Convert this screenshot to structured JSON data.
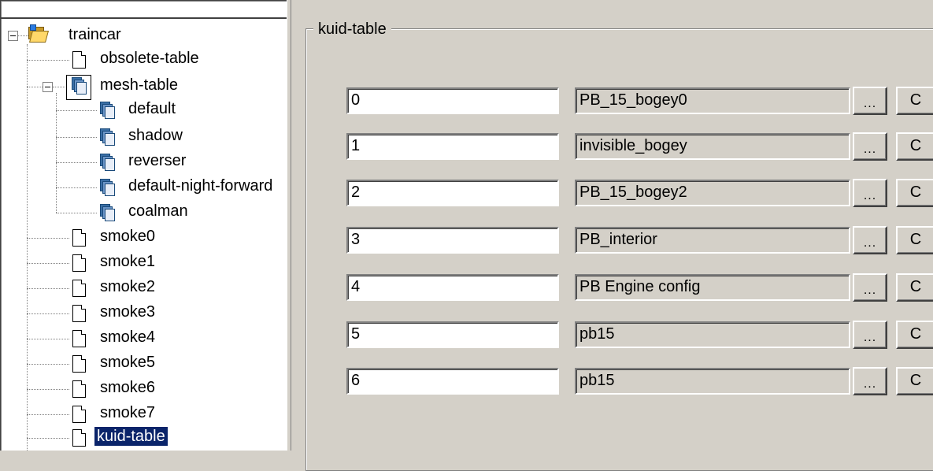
{
  "tree": {
    "root": {
      "label": "traincar",
      "icon": "folder-icon"
    },
    "nodes": [
      {
        "label": "obsolete-table",
        "icon": "doc-icon"
      },
      {
        "label": "mesh-table",
        "icon": "mesh-icon"
      },
      {
        "label": "default",
        "icon": "mesh-icon"
      },
      {
        "label": "shadow",
        "icon": "mesh-icon"
      },
      {
        "label": "reverser",
        "icon": "mesh-icon"
      },
      {
        "label": "default-night-forward",
        "icon": "mesh-icon"
      },
      {
        "label": "coalman",
        "icon": "mesh-icon"
      },
      {
        "label": "smoke0",
        "icon": "doc-icon"
      },
      {
        "label": "smoke1",
        "icon": "doc-icon"
      },
      {
        "label": "smoke2",
        "icon": "doc-icon"
      },
      {
        "label": "smoke3",
        "icon": "doc-icon"
      },
      {
        "label": "smoke4",
        "icon": "doc-icon"
      },
      {
        "label": "smoke5",
        "icon": "doc-icon"
      },
      {
        "label": "smoke6",
        "icon": "doc-icon"
      },
      {
        "label": "smoke7",
        "icon": "doc-icon"
      },
      {
        "label": "kuid-table",
        "icon": "doc-icon",
        "selected": true
      }
    ]
  },
  "kuid_table": {
    "title": "kuid-table",
    "browse_label": "...",
    "clear_label": "C",
    "rows": [
      {
        "index": "0",
        "kuid": "PB_15_bogey0"
      },
      {
        "index": "1",
        "kuid": "invisible_bogey"
      },
      {
        "index": "2",
        "kuid": "PB_15_bogey2"
      },
      {
        "index": "3",
        "kuid": "PB_interior"
      },
      {
        "index": "4",
        "kuid": "PB Engine config"
      },
      {
        "index": "5",
        "kuid": "pb15"
      },
      {
        "index": "6",
        "kuid": "pb15"
      }
    ]
  },
  "colors": {
    "window_bg": "#d4d0c8",
    "selection_bg": "#0a246a",
    "selection_fg": "#ffffff"
  }
}
